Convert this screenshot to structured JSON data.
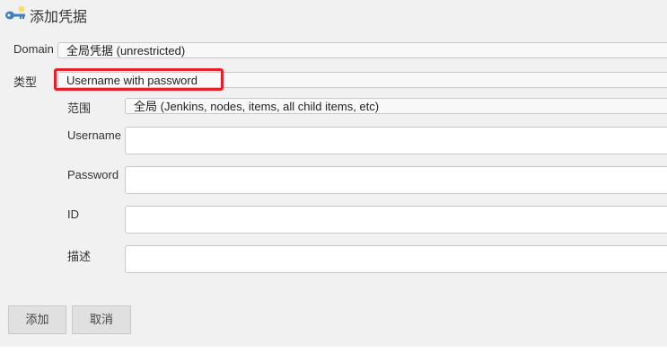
{
  "header": {
    "title": "添加凭据",
    "icon": "key-icon"
  },
  "form": {
    "domain": {
      "label": "Domain",
      "value": "全局凭据 (unrestricted)"
    },
    "kind": {
      "label": "类型",
      "value": "Username with password"
    },
    "scope": {
      "label": "范围",
      "value": "全局 (Jenkins, nodes, items, all child items, etc)"
    },
    "username": {
      "label": "Username",
      "value": ""
    },
    "password": {
      "label": "Password",
      "value": ""
    },
    "id": {
      "label": "ID",
      "value": ""
    },
    "description": {
      "label": "描述",
      "value": ""
    }
  },
  "buttons": {
    "add": "添加",
    "cancel": "取消"
  },
  "colors": {
    "highlight": "#e8202a",
    "background": "#f1f1f1"
  }
}
